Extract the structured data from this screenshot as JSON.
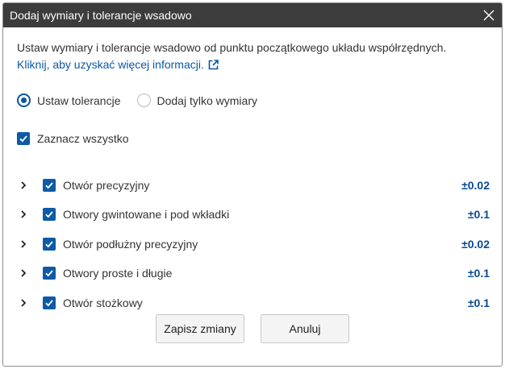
{
  "dialog": {
    "title": "Dodaj wymiary i tolerancje wsadowo",
    "description": "Ustaw wymiary i tolerancje wsadowo od punktu początkowego układu współrzędnych.",
    "link_text": "Kliknij, aby uzyskać więcej informacji."
  },
  "mode": {
    "options": [
      {
        "label": "Ustaw tolerancje",
        "selected": true
      },
      {
        "label": "Dodaj tylko wymiary",
        "selected": false
      }
    ]
  },
  "select_all": {
    "label": "Zaznacz wszystko",
    "checked": true
  },
  "features": [
    {
      "label": "Otwór precyzyjny",
      "tolerance": "±0.02",
      "checked": true
    },
    {
      "label": "Otwory gwintowane i pod wkładki",
      "tolerance": "±0.1",
      "checked": true
    },
    {
      "label": "Otwór podłużny precyzyjny",
      "tolerance": "±0.02",
      "checked": true
    },
    {
      "label": "Otwory proste i długie",
      "tolerance": "±0.1",
      "checked": true
    },
    {
      "label": "Otwór stożkowy",
      "tolerance": "±0.1",
      "checked": true
    }
  ],
  "buttons": {
    "save": "Zapisz zmiany",
    "cancel": "Anuluj"
  },
  "colors": {
    "accent": "#0e5aa7",
    "titlebar": "#3c3c3c",
    "link": "#0b57a6"
  },
  "icons": {
    "close": "close-icon",
    "external": "external-link-icon",
    "expand": "chevron-right-icon",
    "check": "checkmark-icon"
  }
}
